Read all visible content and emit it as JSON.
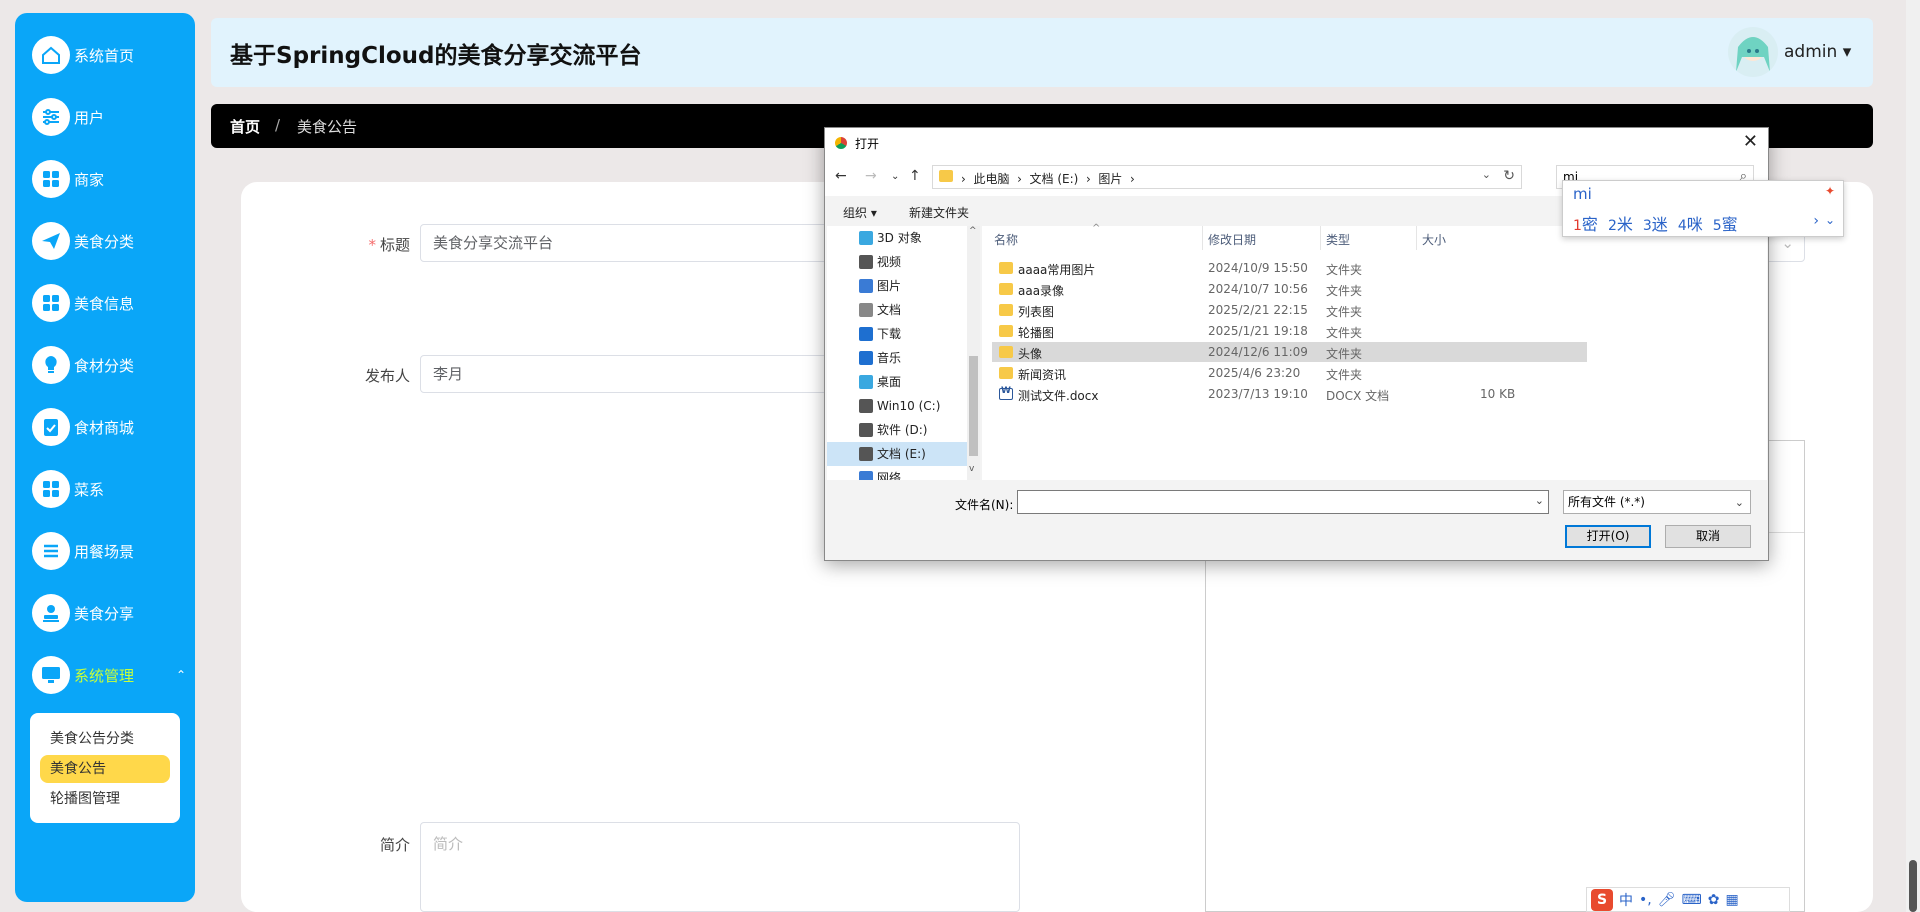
{
  "sidebar": {
    "items": [
      {
        "label": "系统首页",
        "icon": "home-icon"
      },
      {
        "label": "用户",
        "icon": "sliders-icon"
      },
      {
        "label": "商家",
        "icon": "grid-icon"
      },
      {
        "label": "美食分类",
        "icon": "send-icon"
      },
      {
        "label": "美食信息",
        "icon": "grid-icon"
      },
      {
        "label": "食材分类",
        "icon": "bulb-icon"
      },
      {
        "label": "食材商城",
        "icon": "clipboard-check-icon"
      },
      {
        "label": "菜系",
        "icon": "grid-icon"
      },
      {
        "label": "用餐场景",
        "icon": "list-icon"
      },
      {
        "label": "美食分享",
        "icon": "stamp-icon"
      },
      {
        "label": "系统管理",
        "icon": "monitor-icon"
      }
    ],
    "submenu": [
      "美食公告分类",
      "美食公告",
      "轮播图管理"
    ]
  },
  "header": {
    "title": "基于SpringCloud的美食分享交流平台",
    "username": "admin"
  },
  "breadcrumb": {
    "home": "首页",
    "sep": "/",
    "current": "美食公告"
  },
  "form": {
    "title_label": "标题",
    "title_value": "美食分享交流平台",
    "publisher_label": "发布人",
    "publisher_value": "李月",
    "intro_label": "简介",
    "intro_placeholder": "简介"
  },
  "dialog": {
    "title": "打开",
    "path": [
      "此电脑",
      "文档 (E:)",
      "图片"
    ],
    "search_value": "mi",
    "organize": "组织",
    "new_folder": "新建文件夹",
    "tree": [
      {
        "label": "3D 对象",
        "icon": "cube-icon"
      },
      {
        "label": "视频",
        "icon": "video-icon"
      },
      {
        "label": "图片",
        "icon": "picture-icon"
      },
      {
        "label": "文档",
        "icon": "document-icon"
      },
      {
        "label": "下载",
        "icon": "download-icon"
      },
      {
        "label": "音乐",
        "icon": "music-icon"
      },
      {
        "label": "桌面",
        "icon": "desktop-icon"
      },
      {
        "label": "Win10 (C:)",
        "icon": "windows-drive-icon"
      },
      {
        "label": "软件 (D:)",
        "icon": "drive-icon"
      },
      {
        "label": "文档 (E:)",
        "icon": "drive-icon"
      },
      {
        "label": "网络",
        "icon": "network-icon"
      }
    ],
    "columns": {
      "name": "名称",
      "date": "修改日期",
      "type": "类型",
      "size": "大小"
    },
    "files": [
      {
        "name": "aaaa常用图片",
        "date": "2024/10/9 15:50",
        "type": "文件夹",
        "size": ""
      },
      {
        "name": "aaa录像",
        "date": "2024/10/7 10:56",
        "type": "文件夹",
        "size": ""
      },
      {
        "name": "列表图",
        "date": "2025/2/21 22:15",
        "type": "文件夹",
        "size": ""
      },
      {
        "name": "轮播图",
        "date": "2025/1/21 19:18",
        "type": "文件夹",
        "size": ""
      },
      {
        "name": "头像",
        "date": "2024/12/6 11:09",
        "type": "文件夹",
        "size": ""
      },
      {
        "name": "新闻资讯",
        "date": "2025/4/6 23:20",
        "type": "文件夹",
        "size": ""
      },
      {
        "name": "测试文件.docx",
        "date": "2023/7/13 19:10",
        "type": "DOCX 文档",
        "size": "10 KB"
      }
    ],
    "filename_label": "文件名(N):",
    "filetype": "所有文件 (*.*)",
    "open_button": "打开(O)",
    "cancel_button": "取消"
  },
  "ime": {
    "pinyin": "mi",
    "candidates": [
      {
        "n": "1",
        "c": "密"
      },
      {
        "n": "2",
        "c": "米"
      },
      {
        "n": "3",
        "c": "迷"
      },
      {
        "n": "4",
        "c": "咪"
      },
      {
        "n": "5",
        "c": "蜜"
      }
    ],
    "bar_lang": "中"
  },
  "colors": {
    "sidebar": "#0aa6f8",
    "active_submenu": "#ffd84a",
    "active_menu_text": "#c7ff3a",
    "header_bg": "#e1f3fd"
  }
}
